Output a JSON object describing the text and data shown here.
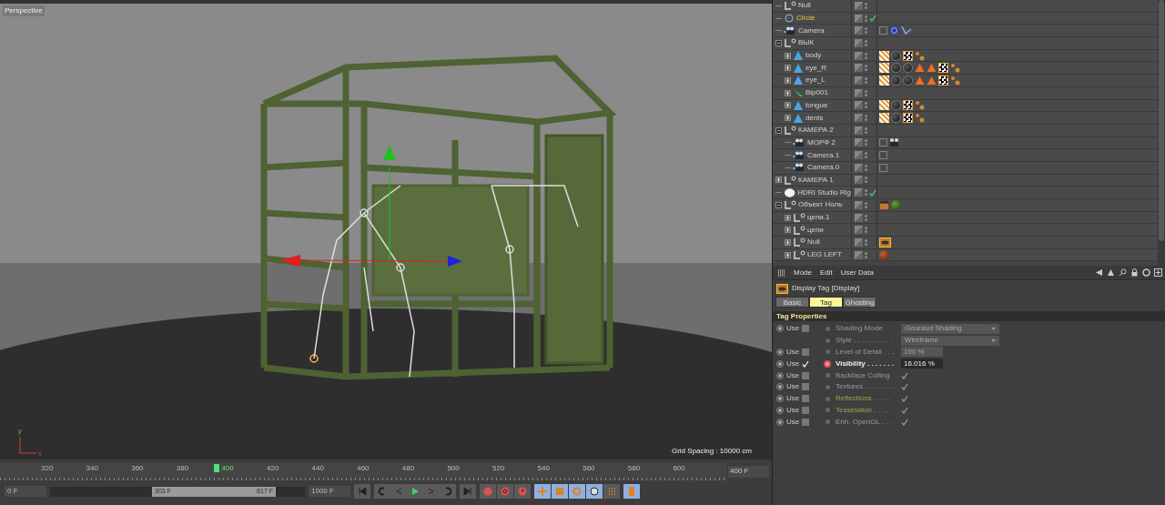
{
  "viewport": {
    "label": "Perspective",
    "grid_spacing": "Grid Spacing : 10000 cm",
    "axis_labels": [
      "y",
      "x"
    ]
  },
  "objects": [
    {
      "name": "Null",
      "kind": "null",
      "selected": false,
      "check": false
    },
    {
      "name": "Circle",
      "kind": "circle",
      "selected": true,
      "check": true
    },
    {
      "name": "Camera",
      "kind": "camera",
      "selected": false,
      "check": false,
      "tags": [
        {
          "kind": "protect"
        },
        {
          "kind": "target"
        },
        {
          "kind": "ik"
        }
      ]
    },
    {
      "name": "ВЫК",
      "kind": "null",
      "selected": false,
      "check": false,
      "expanded": true,
      "children": [
        {
          "name": "body",
          "kind": "polygon",
          "selected": false,
          "check": false,
          "expanded": false,
          "tags": [
            {
              "kind": "texture"
            },
            {
              "kind": "material-dark"
            },
            {
              "kind": "uvw"
            },
            {
              "kind": "selection"
            }
          ]
        },
        {
          "name": "eye_R",
          "kind": "polygon",
          "selected": false,
          "check": false,
          "expanded": false,
          "tags": [
            {
              "kind": "texture"
            },
            {
              "kind": "material-dark"
            },
            {
              "kind": "material-dark"
            },
            {
              "kind": "cone"
            },
            {
              "kind": "cone"
            },
            {
              "kind": "uvw"
            },
            {
              "kind": "selection"
            }
          ]
        },
        {
          "name": "eye_L",
          "kind": "polygon",
          "selected": false,
          "check": false,
          "expanded": false,
          "tags": [
            {
              "kind": "texture"
            },
            {
              "kind": "material-dark"
            },
            {
              "kind": "material-dark"
            },
            {
              "kind": "cone"
            },
            {
              "kind": "cone"
            },
            {
              "kind": "uvw"
            },
            {
              "kind": "selection"
            }
          ]
        },
        {
          "name": "Bip001",
          "kind": "bone",
          "selected": false,
          "check": false,
          "expanded": false
        },
        {
          "name": "tongue",
          "kind": "polygon",
          "selected": false,
          "check": false,
          "expanded": false,
          "tags": [
            {
              "kind": "texture"
            },
            {
              "kind": "material-dark"
            },
            {
              "kind": "uvw"
            },
            {
              "kind": "selection"
            }
          ]
        },
        {
          "name": "dents",
          "kind": "polygon",
          "selected": false,
          "check": false,
          "expanded": false,
          "tags": [
            {
              "kind": "texture"
            },
            {
              "kind": "material-dark"
            },
            {
              "kind": "uvw"
            },
            {
              "kind": "selection"
            }
          ]
        }
      ]
    },
    {
      "name": "КАМЕРА 2",
      "kind": "null",
      "selected": false,
      "check": false,
      "expanded": true,
      "children": [
        {
          "name": "МОРФ 2",
          "kind": "camera",
          "selected": false,
          "check": false,
          "tags": [
            {
              "kind": "protect"
            },
            {
              "kind": "morph"
            }
          ]
        },
        {
          "name": "Camera.1",
          "kind": "camera",
          "selected": false,
          "check": false,
          "tags": [
            {
              "kind": "protect"
            }
          ]
        },
        {
          "name": "Camera.0",
          "kind": "camera",
          "selected": false,
          "check": false,
          "tags": [
            {
              "kind": "protect"
            }
          ]
        }
      ]
    },
    {
      "name": "КАМЕРА 1",
      "kind": "null",
      "selected": false,
      "check": false,
      "expanded": false
    },
    {
      "name": "HDRI Studio Rig",
      "kind": "sky",
      "selected": false,
      "check": true
    },
    {
      "name": "Объект Ноль",
      "kind": "null",
      "selected": false,
      "check": false,
      "expanded": true,
      "tags": [
        {
          "kind": "cinema"
        },
        {
          "kind": "material-green"
        }
      ],
      "children": [
        {
          "name": "цепи.1",
          "kind": "null",
          "selected": false,
          "check": false,
          "expanded": false
        },
        {
          "name": "цепи",
          "kind": "null",
          "selected": false,
          "check": false,
          "expanded": false
        },
        {
          "name": "Null",
          "kind": "null",
          "selected": false,
          "check": false,
          "expanded": false,
          "tags": [
            {
              "kind": "display"
            }
          ]
        },
        {
          "name": "LEG LEFT",
          "kind": "null",
          "selected": false,
          "check": false,
          "expanded": false,
          "tags": [
            {
              "kind": "material-red"
            }
          ]
        }
      ]
    }
  ],
  "attributes": {
    "menu": [
      "Mode",
      "Edit",
      "User Data"
    ],
    "title": "Display Tag [Display]",
    "tabs": [
      {
        "label": "Basic",
        "selected": false
      },
      {
        "label": "Tag",
        "selected": true
      },
      {
        "label": "Ghosting",
        "selected": false
      }
    ],
    "section": "Tag Properties",
    "rows": [
      {
        "use": "Use",
        "checked": false,
        "label": "Shading Mode",
        "kind": "dropdown",
        "value": "Gouraud Shading",
        "disabled": true,
        "highlighted": false
      },
      {
        "label": "Style . . . . . . . . . .",
        "kind": "dropdown",
        "value": "Wireframe",
        "disabled": true,
        "highlighted": false
      },
      {
        "use": "Use",
        "checked": false,
        "label": "Level of Detail . . .",
        "kind": "number",
        "value": "100 %",
        "disabled": true,
        "highlighted": false
      },
      {
        "use": "Use",
        "checked": true,
        "label": "Visibility . . . . . . .",
        "kind": "number",
        "value": "16.016 %",
        "disabled": false,
        "keyed": true,
        "highlighted": false
      },
      {
        "use": "Use",
        "checked": false,
        "label": "Backface Culling",
        "kind": "check",
        "disabled": true,
        "highlighted": false
      },
      {
        "use": "Use",
        "checked": false,
        "label": "Textures . . . . . . . .",
        "kind": "check",
        "disabled": true,
        "highlighted": false
      },
      {
        "use": "Use",
        "checked": false,
        "label": "Reflections. . . . .",
        "kind": "check",
        "disabled": true,
        "highlighted": true
      },
      {
        "use": "Use",
        "checked": false,
        "label": "Tesselation . . . .",
        "kind": "check",
        "disabled": true,
        "highlighted": true
      },
      {
        "use": "Use",
        "checked": false,
        "label": "Enh. OpenGL . . .",
        "kind": "check",
        "disabled": true,
        "highlighted": false
      }
    ]
  },
  "timeline": {
    "ticks": [
      {
        "label": "320",
        "current": false
      },
      {
        "label": "340",
        "current": false
      },
      {
        "label": "360",
        "current": false
      },
      {
        "label": "380",
        "current": false
      },
      {
        "label": "400",
        "current": true
      },
      {
        "label": "420",
        "current": false
      },
      {
        "label": "440",
        "current": false
      },
      {
        "label": "460",
        "current": false
      },
      {
        "label": "480",
        "current": false
      },
      {
        "label": "500",
        "current": false
      },
      {
        "label": "520",
        "current": false
      },
      {
        "label": "540",
        "current": false
      },
      {
        "label": "560",
        "current": false
      },
      {
        "label": "580",
        "current": false
      },
      {
        "label": "600",
        "current": false
      }
    ],
    "start": "0 F",
    "range_start": "303 F",
    "range_end": "617 F",
    "end": "1000 F",
    "frame": "400 F"
  }
}
